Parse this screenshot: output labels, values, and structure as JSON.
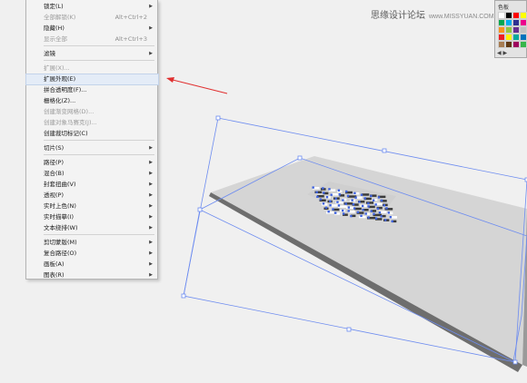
{
  "menu": {
    "items": [
      {
        "label": "锁定(L)",
        "shortcut": "",
        "submenu": true,
        "disabled": false
      },
      {
        "label": "全部解锁(K)",
        "shortcut": "Alt+Ctrl+2",
        "submenu": false,
        "disabled": true
      },
      {
        "label": "隐藏(H)",
        "shortcut": "",
        "submenu": true,
        "disabled": false
      },
      {
        "label": "显示全部",
        "shortcut": "Alt+Ctrl+3",
        "submenu": false,
        "disabled": true
      },
      {
        "label": "滤镜",
        "shortcut": "",
        "submenu": true,
        "disabled": false
      },
      {
        "label": "扩展(X)...",
        "shortcut": "",
        "submenu": false,
        "disabled": true
      },
      {
        "label": "扩展外观(E)",
        "shortcut": "",
        "submenu": false,
        "disabled": false,
        "highlighted": true
      },
      {
        "label": "拼合透明度(F)...",
        "shortcut": "",
        "submenu": false,
        "disabled": false
      },
      {
        "label": "栅格化(Z)...",
        "shortcut": "",
        "submenu": false,
        "disabled": false
      },
      {
        "label": "创建渐变网格(D)...",
        "shortcut": "",
        "submenu": false,
        "disabled": true
      },
      {
        "label": "创建对象马赛克(J)...",
        "shortcut": "",
        "submenu": false,
        "disabled": true
      },
      {
        "label": "创建裁切标记(C)",
        "shortcut": "",
        "submenu": false,
        "disabled": false
      },
      {
        "label": "切片(S)",
        "shortcut": "",
        "submenu": true,
        "disabled": false
      },
      {
        "label": "路径(P)",
        "shortcut": "",
        "submenu": true,
        "disabled": false
      },
      {
        "label": "混合(B)",
        "shortcut": "",
        "submenu": true,
        "disabled": false
      },
      {
        "label": "封套扭曲(V)",
        "shortcut": "",
        "submenu": true,
        "disabled": false
      },
      {
        "label": "透视(P)",
        "shortcut": "",
        "submenu": true,
        "disabled": false
      },
      {
        "label": "实时上色(N)",
        "shortcut": "",
        "submenu": true,
        "disabled": false
      },
      {
        "label": "实时描摹(I)",
        "shortcut": "",
        "submenu": true,
        "disabled": false
      },
      {
        "label": "文本绕排(W)",
        "shortcut": "",
        "submenu": true,
        "disabled": false
      },
      {
        "label": "剪切蒙版(M)",
        "shortcut": "",
        "submenu": true,
        "disabled": false
      },
      {
        "label": "复合路径(O)",
        "shortcut": "",
        "submenu": true,
        "disabled": false
      },
      {
        "label": "画板(A)",
        "shortcut": "",
        "submenu": true,
        "disabled": false
      },
      {
        "label": "图表(R)",
        "shortcut": "",
        "submenu": true,
        "disabled": false
      }
    ]
  },
  "watermark": {
    "text": "思缘设计论坛",
    "url": "www.MISSYUAN.COM"
  },
  "swatches": {
    "title": "色板",
    "colors": [
      "#ffffff",
      "#000000",
      "#ff0000",
      "#ffff00",
      "#00a651",
      "#00aeef",
      "#2e3192",
      "#ec008c",
      "#f7941d",
      "#8dc63f",
      "#662d91",
      "#c2c2c2",
      "#ed1c24",
      "#fff200",
      "#00a99d",
      "#0072bc",
      "#a67c52",
      "#603913",
      "#9e005d",
      "#39b54a"
    ],
    "footer": "◀  ▶"
  },
  "colors": {
    "accent": "#4a6fe0",
    "arrow": "#e03030"
  }
}
